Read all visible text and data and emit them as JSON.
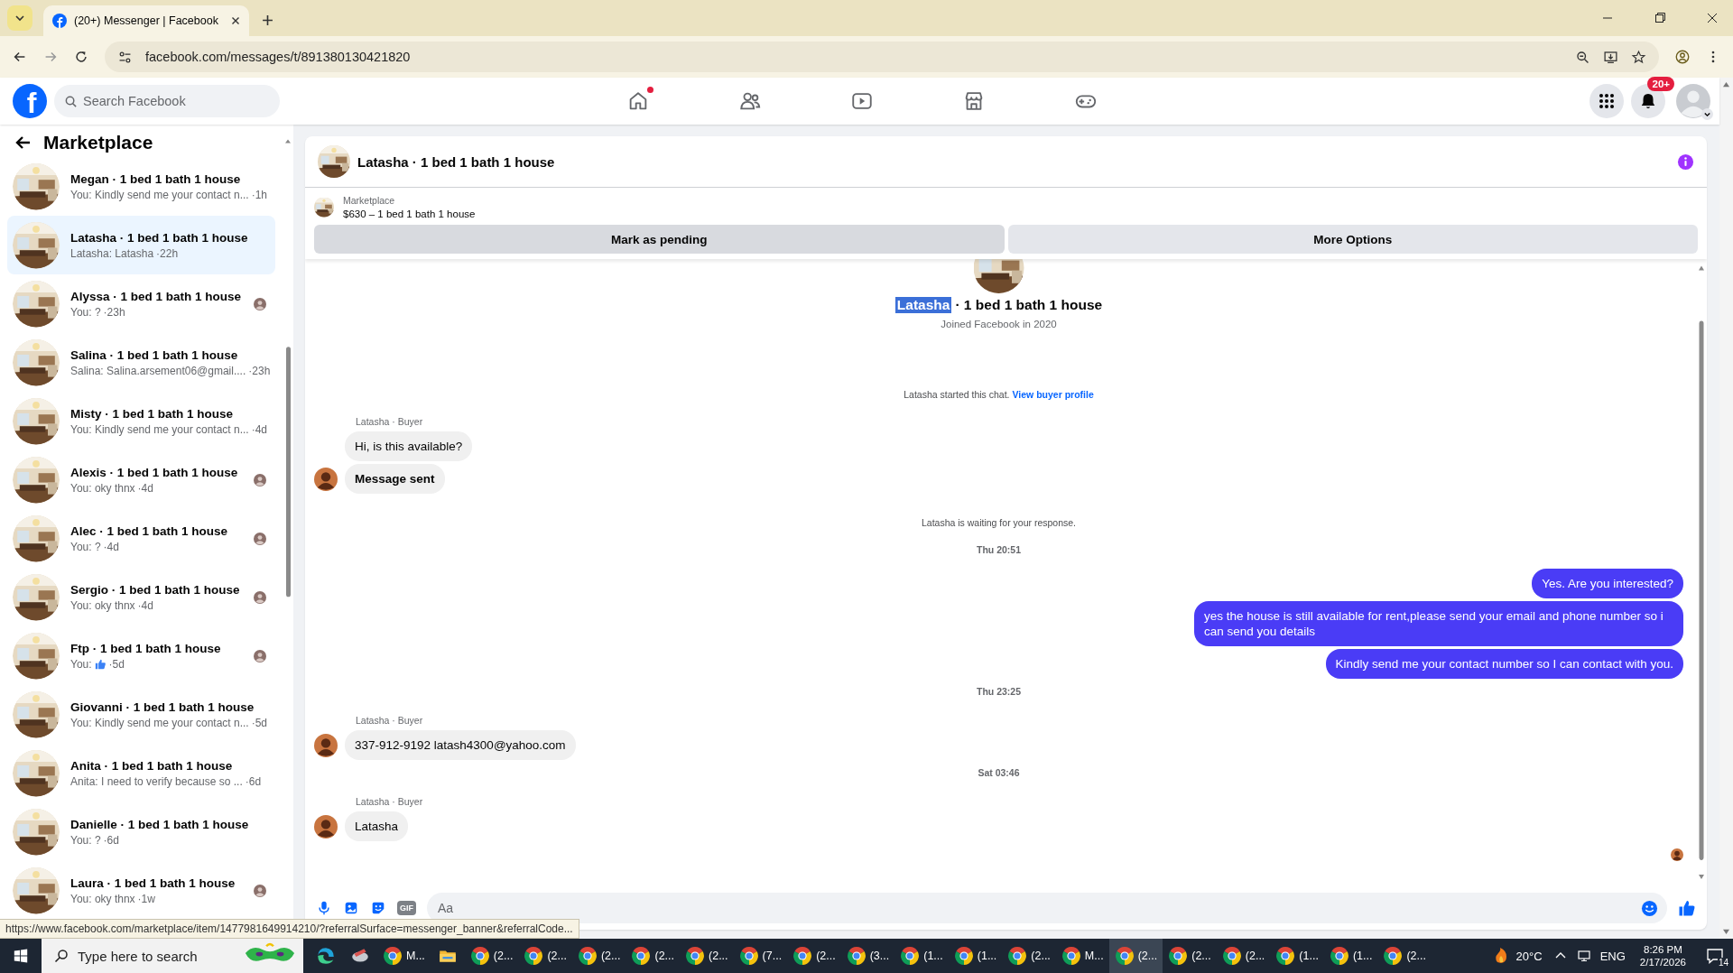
{
  "browser": {
    "tab": {
      "title": "(20+) Messenger | Facebook",
      "selected": true
    },
    "url": "facebook.com/messages/t/891380130421820",
    "status_url": "https://www.facebook.com/marketplace/item/1477981649914210/?referralSurface=messenger_banner&referralCode..."
  },
  "facebook": {
    "logo": "f",
    "search": {
      "placeholder": "Search Facebook"
    },
    "nav": [
      {
        "kind": "home",
        "dot": true
      },
      {
        "kind": "friends",
        "dot": false
      },
      {
        "kind": "video",
        "dot": false
      },
      {
        "kind": "marketplace",
        "dot": false
      },
      {
        "kind": "gaming",
        "dot": false
      }
    ],
    "notifications_badge": "20+"
  },
  "sidebar": {
    "title": "Marketplace",
    "threads": [
      {
        "name": "Megan · 1 bed 1 bath 1 house",
        "preview": "You: Kindly send me your contact n...",
        "time": "·1h",
        "kind": "text",
        "seen": false,
        "selected": false
      },
      {
        "name": "Latasha · 1 bed 1 bath 1 house",
        "preview": "Latasha: Latasha",
        "time": "·22h",
        "kind": "text",
        "seen": false,
        "selected": true
      },
      {
        "name": "Alyssa · 1 bed 1 bath 1 house",
        "preview": "You: ?",
        "time": "·23h",
        "kind": "text",
        "seen": true,
        "selected": false
      },
      {
        "name": "Salina · 1 bed 1 bath 1 house",
        "preview": "Salina: Salina.arsement06@gmail....",
        "time": "·23h",
        "kind": "text",
        "seen": false,
        "selected": false
      },
      {
        "name": "Misty · 1 bed 1 bath 1 house",
        "preview": "You: Kindly send me your contact n...",
        "time": "·4d",
        "kind": "text",
        "seen": false,
        "selected": false
      },
      {
        "name": "Alexis · 1 bed 1 bath 1 house",
        "preview": "You: oky thnx",
        "time": "·4d",
        "kind": "text",
        "seen": true,
        "selected": false
      },
      {
        "name": "Alec · 1 bed 1 bath 1 house",
        "preview": "You: ?",
        "time": "·4d",
        "kind": "text",
        "seen": true,
        "selected": false
      },
      {
        "name": "Sergio · 1 bed 1 bath 1 house",
        "preview": "You: oky thnx",
        "time": "·4d",
        "kind": "text",
        "seen": true,
        "selected": false
      },
      {
        "name": "Ftp · 1 bed 1 bath 1 house",
        "preview": "You:",
        "time": "·5d",
        "kind": "like",
        "seen": true,
        "selected": false
      },
      {
        "name": "Giovanni · 1 bed 1 bath 1 house",
        "preview": "You: Kindly send me your contact n...",
        "time": "·5d",
        "kind": "text",
        "seen": false,
        "selected": false
      },
      {
        "name": "Anita · 1 bed 1 bath 1 house",
        "preview": "Anita: I need to verify because so ...",
        "time": "·6d",
        "kind": "text",
        "seen": false,
        "selected": false
      },
      {
        "name": "Danielle · 1 bed 1 bath 1 house",
        "preview": "You: ?",
        "time": "·6d",
        "kind": "text",
        "seen": false,
        "selected": false
      },
      {
        "name": "Laura · 1 bed 1 bath 1 house",
        "preview": "You: oky thnx",
        "time": "·1w",
        "kind": "text",
        "seen": true,
        "selected": false
      }
    ]
  },
  "chat": {
    "title": "Latasha · 1 bed 1 bath 1 house",
    "banner": {
      "label": "Marketplace",
      "listing": "$630 – 1 bed 1 bath 1 house"
    },
    "actions": [
      {
        "label": "Mark as pending",
        "kind": "primary"
      },
      {
        "label": "More Options",
        "kind": "secondary"
      }
    ],
    "profile": {
      "highlighted": "Latasha",
      "rest": "· 1 bed 1 bath 1 house",
      "joined": "Joined Facebook in 2020"
    },
    "messages": [
      {
        "kind": "system",
        "text": "Latasha started this chat.",
        "link": "View buyer profile"
      },
      {
        "kind": "sender",
        "text": "Latasha · Buyer"
      },
      {
        "kind": "incoming",
        "text": "Hi, is this available?",
        "avatar": false,
        "bold": false
      },
      {
        "kind": "incoming",
        "text": "Message sent",
        "avatar": true,
        "bold": true
      },
      {
        "kind": "system",
        "text": "Latasha is waiting for your response."
      },
      {
        "kind": "time",
        "text": "Thu 20:51"
      },
      {
        "kind": "outgoing",
        "text": "Yes. Are you interested?"
      },
      {
        "kind": "outgoing",
        "text": "yes the house is still available for rent,please send your email and phone number so i can send you details"
      },
      {
        "kind": "outgoing",
        "text": "Kindly send me your contact number so I can contact with you."
      },
      {
        "kind": "time",
        "text": "Thu 23:25"
      },
      {
        "kind": "sender",
        "text": "Latasha · Buyer"
      },
      {
        "kind": "incoming",
        "text": "337-912-9192 latash4300@yahoo.com",
        "avatar": true,
        "bold": false
      },
      {
        "kind": "time",
        "text": "Sat 03:46"
      },
      {
        "kind": "sender",
        "text": "Latasha · Buyer"
      },
      {
        "kind": "incoming",
        "text": "Latasha",
        "avatar": true,
        "bold": false
      }
    ],
    "read_receipt": true,
    "composer": {
      "gif": "GIF",
      "placeholder": "Aa"
    }
  },
  "taskbar": {
    "search": {
      "placeholder": "Type here to search"
    },
    "apps": [
      {
        "kind": "edge",
        "selected": false
      },
      {
        "kind": "app",
        "selected": false
      },
      {
        "kind": "chrome",
        "label": "M...",
        "selected": false
      },
      {
        "kind": "explorer",
        "selected": false
      },
      {
        "kind": "chrome",
        "label": "(2...",
        "selected": false
      },
      {
        "kind": "chrome",
        "label": "(2...",
        "selected": false
      },
      {
        "kind": "chrome",
        "label": "(2...",
        "selected": false
      },
      {
        "kind": "chrome",
        "label": "(2...",
        "selected": false
      },
      {
        "kind": "chrome",
        "label": "(2...",
        "selected": false
      },
      {
        "kind": "chrome",
        "label": "(7...",
        "selected": false
      },
      {
        "kind": "chrome",
        "label": "(2...",
        "selected": false
      },
      {
        "kind": "chrome",
        "label": "(3...",
        "selected": false
      },
      {
        "kind": "chrome",
        "label": "(1...",
        "selected": false
      },
      {
        "kind": "chrome",
        "label": "(1...",
        "selected": false
      },
      {
        "kind": "chrome",
        "label": "(2...",
        "selected": false
      },
      {
        "kind": "chrome",
        "label": "M...",
        "selected": false
      },
      {
        "kind": "chrome",
        "label": "(2...",
        "selected": true
      },
      {
        "kind": "chrome",
        "label": "(2...",
        "selected": false
      },
      {
        "kind": "chrome",
        "label": "(2...",
        "selected": false
      },
      {
        "kind": "chrome",
        "label": "(1...",
        "selected": false
      },
      {
        "kind": "chrome",
        "label": "(1...",
        "selected": false
      },
      {
        "kind": "chrome",
        "label": "(2...",
        "selected": false
      }
    ],
    "temperature": "20°C",
    "language": "ENG",
    "time": "8:26 PM",
    "date": "2/17/2026",
    "notifications": "14"
  }
}
